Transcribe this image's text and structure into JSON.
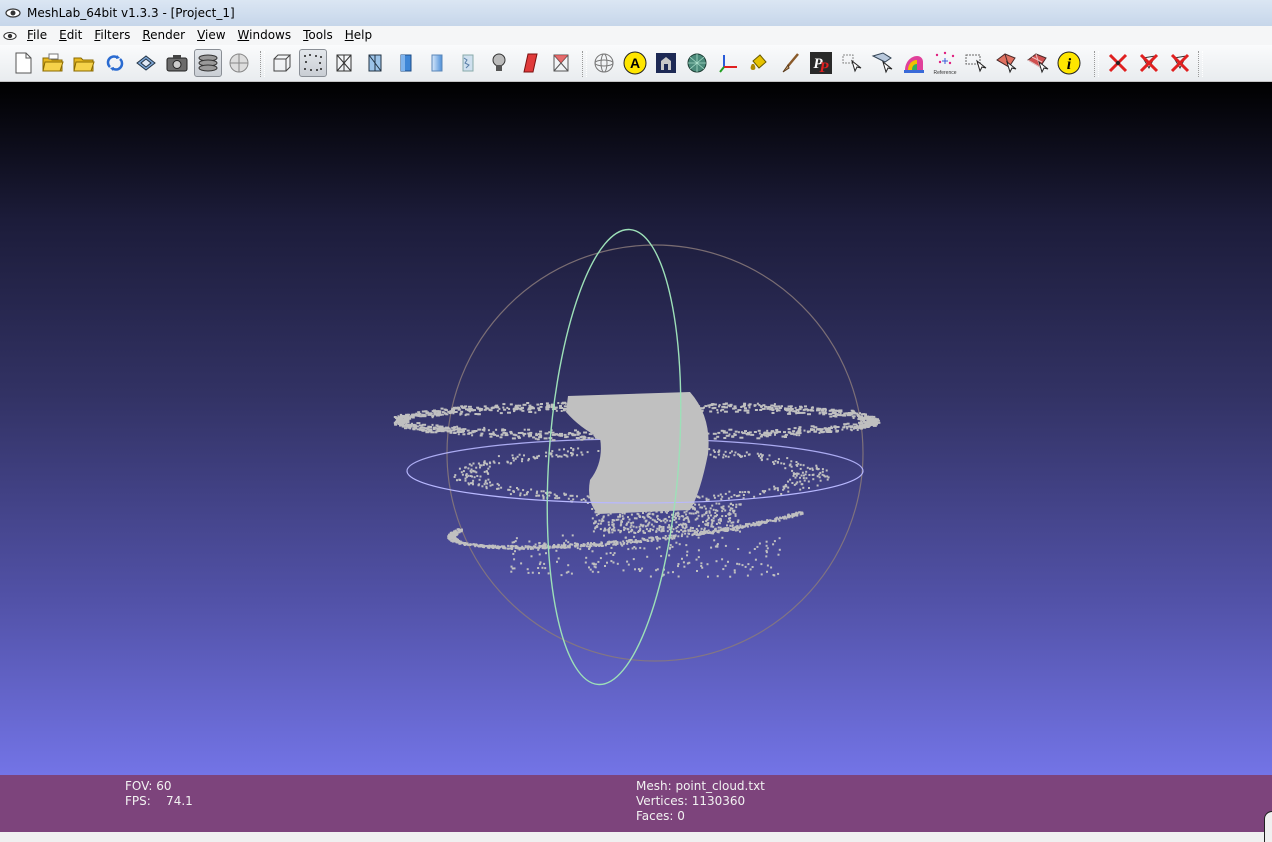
{
  "window": {
    "title": "MeshLab_64bit v1.3.3 - [Project_1]"
  },
  "menu": {
    "items": [
      "File",
      "Edit",
      "Filters",
      "Render",
      "View",
      "Windows",
      "Tools",
      "Help"
    ]
  },
  "toolbar": {
    "buttons": [
      {
        "name": "new-project-icon",
        "active": false
      },
      {
        "name": "open-project-icon",
        "active": false
      },
      {
        "name": "import-mesh-icon",
        "active": false
      },
      {
        "name": "reload-icon",
        "active": false
      },
      {
        "name": "export-mesh-icon",
        "active": false
      },
      {
        "name": "snapshot-icon",
        "active": false
      },
      {
        "name": "layers-icon",
        "active": true
      },
      {
        "name": "raster-icon",
        "active": false
      },
      {
        "name": "bbox-render-icon",
        "active": false
      },
      {
        "name": "points-render-icon",
        "active": true
      },
      {
        "name": "wireframe-render-icon",
        "active": false
      },
      {
        "name": "hidden-lines-render-icon",
        "active": false
      },
      {
        "name": "flat-shading-icon",
        "active": false
      },
      {
        "name": "smooth-shading-icon",
        "active": false
      },
      {
        "name": "texture-render-icon",
        "active": false
      },
      {
        "name": "light-bulb-icon",
        "active": false
      },
      {
        "name": "backface-culling-icon",
        "active": false
      },
      {
        "name": "selected-faces-render-icon",
        "active": false
      },
      {
        "name": "trackball-icon",
        "active": false
      },
      {
        "name": "annotation-a-icon",
        "active": false
      },
      {
        "name": "raster-camera-icon",
        "active": false
      },
      {
        "name": "mesh-ball-icon",
        "active": false
      },
      {
        "name": "manipulator-axes-icon",
        "active": false
      },
      {
        "name": "paint-bucket-icon",
        "active": false
      },
      {
        "name": "paint-brush-icon",
        "active": false
      },
      {
        "name": "pick-points-icon",
        "active": false
      },
      {
        "name": "measure-tool-icon",
        "active": false
      },
      {
        "name": "align-tool-icon",
        "active": false
      },
      {
        "name": "quality-mapper-icon",
        "active": false
      },
      {
        "name": "reference-scene-icon",
        "active": false
      },
      {
        "name": "select-vertices-icon",
        "active": false
      },
      {
        "name": "select-faces-icon",
        "active": false
      },
      {
        "name": "select-connected-icon",
        "active": false
      },
      {
        "name": "info-icon",
        "active": false
      },
      {
        "name": "delete-vertices-icon",
        "active": false
      },
      {
        "name": "delete-faces-icon",
        "active": false
      },
      {
        "name": "delete-faces-vertices-icon",
        "active": false
      }
    ],
    "reference_label": "Reference"
  },
  "status": {
    "fov_label": "FOV: 60",
    "fps_label": "FPS:    74.1",
    "mesh_label": "Mesh: point_cloud.txt",
    "vertices_label": "Vertices: 1130360",
    "faces_label": "Faces: 0"
  },
  "colors": {
    "info_bar": "#7d447c",
    "viewport_top": "#000000",
    "viewport_bottom": "#7374e6",
    "point_cloud": "#c0c0c0",
    "trackball_vertical": "#9de0b8",
    "trackball_horizontal": "#b8b8ff",
    "trackball_frame": "#8a7a7a",
    "delete_red": "#e02020"
  }
}
